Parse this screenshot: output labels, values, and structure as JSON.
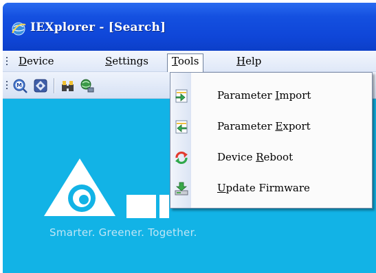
{
  "window": {
    "title": "IEXplorer - [Search]",
    "app_icon": "globe-icon"
  },
  "menubar": {
    "items": [
      {
        "label_parts": [
          "",
          "D",
          "evice"
        ]
      },
      {
        "label_parts": [
          "",
          "S",
          "ettings"
        ]
      },
      {
        "label_parts": [
          "",
          "T",
          "ools"
        ]
      },
      {
        "label_parts": [
          "",
          "H",
          "elp"
        ]
      }
    ]
  },
  "toolbar": {
    "buttons": [
      "magnifier-search-icon",
      "scan-device-icon",
      "find-icon",
      "network-icon"
    ]
  },
  "tools_menu": {
    "items": [
      {
        "icon": "import-arrow-icon",
        "label_parts": [
          "Parameter ",
          "I",
          "mport"
        ]
      },
      {
        "icon": "export-arrow-icon",
        "label_parts": [
          "Parameter ",
          "E",
          "xport"
        ]
      },
      {
        "icon": "reboot-icon",
        "label_parts": [
          "Device ",
          "R",
          "eboot"
        ]
      },
      {
        "icon": "download-firmware-icon",
        "label_parts": [
          "",
          "U",
          "pdate Firmware"
        ]
      }
    ]
  },
  "branding": {
    "logo_icon": "delta-logo-icon",
    "tagline": "Smarter. Greener. Together."
  },
  "colors": {
    "titlebar": "#1450e0",
    "content_bg": "#12b3e6",
    "menu_bg": "#fbfbfb"
  }
}
